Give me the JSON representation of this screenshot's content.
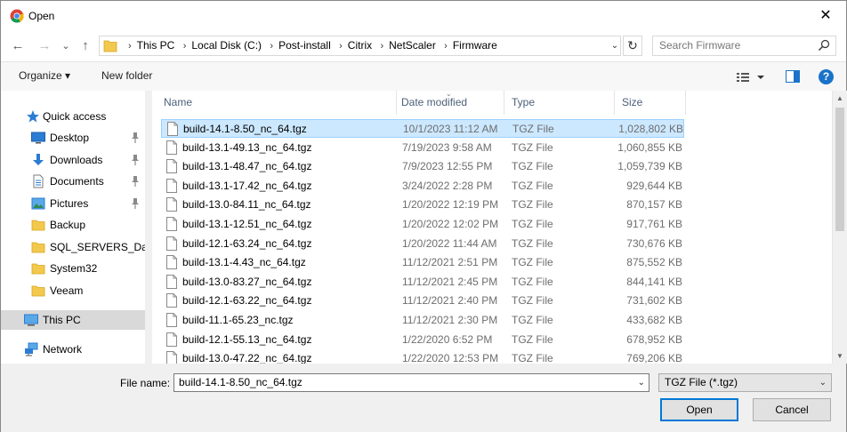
{
  "window": {
    "title": "Open",
    "close_glyph": "✕"
  },
  "nav": {
    "back_glyph": "←",
    "forward_glyph": "→",
    "recent_glyph": "⌄",
    "up_glyph": "↑",
    "refresh_glyph": "↻",
    "breadcrumb": [
      "This PC",
      "Local Disk (C:)",
      "Post-install",
      "Citrix",
      "NetScaler",
      "Firmware"
    ],
    "crumb_separator": "›",
    "address_dropdown_glyph": "⌄"
  },
  "search": {
    "placeholder": "Search Firmware"
  },
  "toolbar": {
    "organize_label": "Organize ▾",
    "new_folder_label": "New folder",
    "help_label": "?"
  },
  "sidebar": {
    "quick_access": "Quick access",
    "items": [
      {
        "label": "Desktop",
        "icon": "desktop-icon",
        "pinned": true
      },
      {
        "label": "Downloads",
        "icon": "downloads-icon",
        "pinned": true
      },
      {
        "label": "Documents",
        "icon": "documents-icon",
        "pinned": true
      },
      {
        "label": "Pictures",
        "icon": "pictures-icon",
        "pinned": true
      },
      {
        "label": "Backup",
        "icon": "folder-icon",
        "pinned": false
      },
      {
        "label": "SQL_SERVERS_Daily_",
        "icon": "folder-icon",
        "pinned": false
      },
      {
        "label": "System32",
        "icon": "folder-icon",
        "pinned": false
      },
      {
        "label": "Veeam",
        "icon": "folder-icon",
        "pinned": false
      }
    ],
    "this_pc": "This PC",
    "network": "Network"
  },
  "columns": {
    "name": "Name",
    "date": "Date modified",
    "type": "Type",
    "size": "Size"
  },
  "files": [
    {
      "name": "build-14.1-8.50_nc_64.tgz",
      "date": "10/1/2023 11:12 AM",
      "type": "TGZ File",
      "size": "1,028,802 KB",
      "selected": true
    },
    {
      "name": "build-13.1-49.13_nc_64.tgz",
      "date": "7/19/2023 9:58 AM",
      "type": "TGZ File",
      "size": "1,060,855 KB"
    },
    {
      "name": "build-13.1-48.47_nc_64.tgz",
      "date": "7/9/2023 12:55 PM",
      "type": "TGZ File",
      "size": "1,059,739 KB"
    },
    {
      "name": "build-13.1-17.42_nc_64.tgz",
      "date": "3/24/2022 2:28 PM",
      "type": "TGZ File",
      "size": "929,644 KB"
    },
    {
      "name": "build-13.0-84.11_nc_64.tgz",
      "date": "1/20/2022 12:19 PM",
      "type": "TGZ File",
      "size": "870,157 KB"
    },
    {
      "name": "build-13.1-12.51_nc_64.tgz",
      "date": "1/20/2022 12:02 PM",
      "type": "TGZ File",
      "size": "917,761 KB"
    },
    {
      "name": "build-12.1-63.24_nc_64.tgz",
      "date": "1/20/2022 11:44 AM",
      "type": "TGZ File",
      "size": "730,676 KB"
    },
    {
      "name": "build-13.1-4.43_nc_64.tgz",
      "date": "11/12/2021 2:51 PM",
      "type": "TGZ File",
      "size": "875,552 KB"
    },
    {
      "name": "build-13.0-83.27_nc_64.tgz",
      "date": "11/12/2021 2:45 PM",
      "type": "TGZ File",
      "size": "844,141 KB"
    },
    {
      "name": "build-12.1-63.22_nc_64.tgz",
      "date": "11/12/2021 2:40 PM",
      "type": "TGZ File",
      "size": "731,602 KB"
    },
    {
      "name": "build-11.1-65.23_nc.tgz",
      "date": "11/12/2021 2:30 PM",
      "type": "TGZ File",
      "size": "433,682 KB"
    },
    {
      "name": "build-12.1-55.13_nc_64.tgz",
      "date": "1/22/2020 6:52 PM",
      "type": "TGZ File",
      "size": "678,952 KB"
    },
    {
      "name": "build-13.0-47.22_nc_64.tgz",
      "date": "1/22/2020 12:53 PM",
      "type": "TGZ File",
      "size": "769,206 KB"
    }
  ],
  "footer": {
    "file_name_label": "File name:",
    "file_name_value": "build-14.1-8.50_nc_64.tgz",
    "file_type_value": "TGZ File (*.tgz)",
    "open_label": "Open",
    "cancel_label": "Cancel",
    "dropdown_glyph": "⌄"
  },
  "colors": {
    "selection_bg": "#cce8ff",
    "selection_border": "#99d1ff",
    "accent": "#0078d7",
    "folder": "#f2c94c"
  }
}
